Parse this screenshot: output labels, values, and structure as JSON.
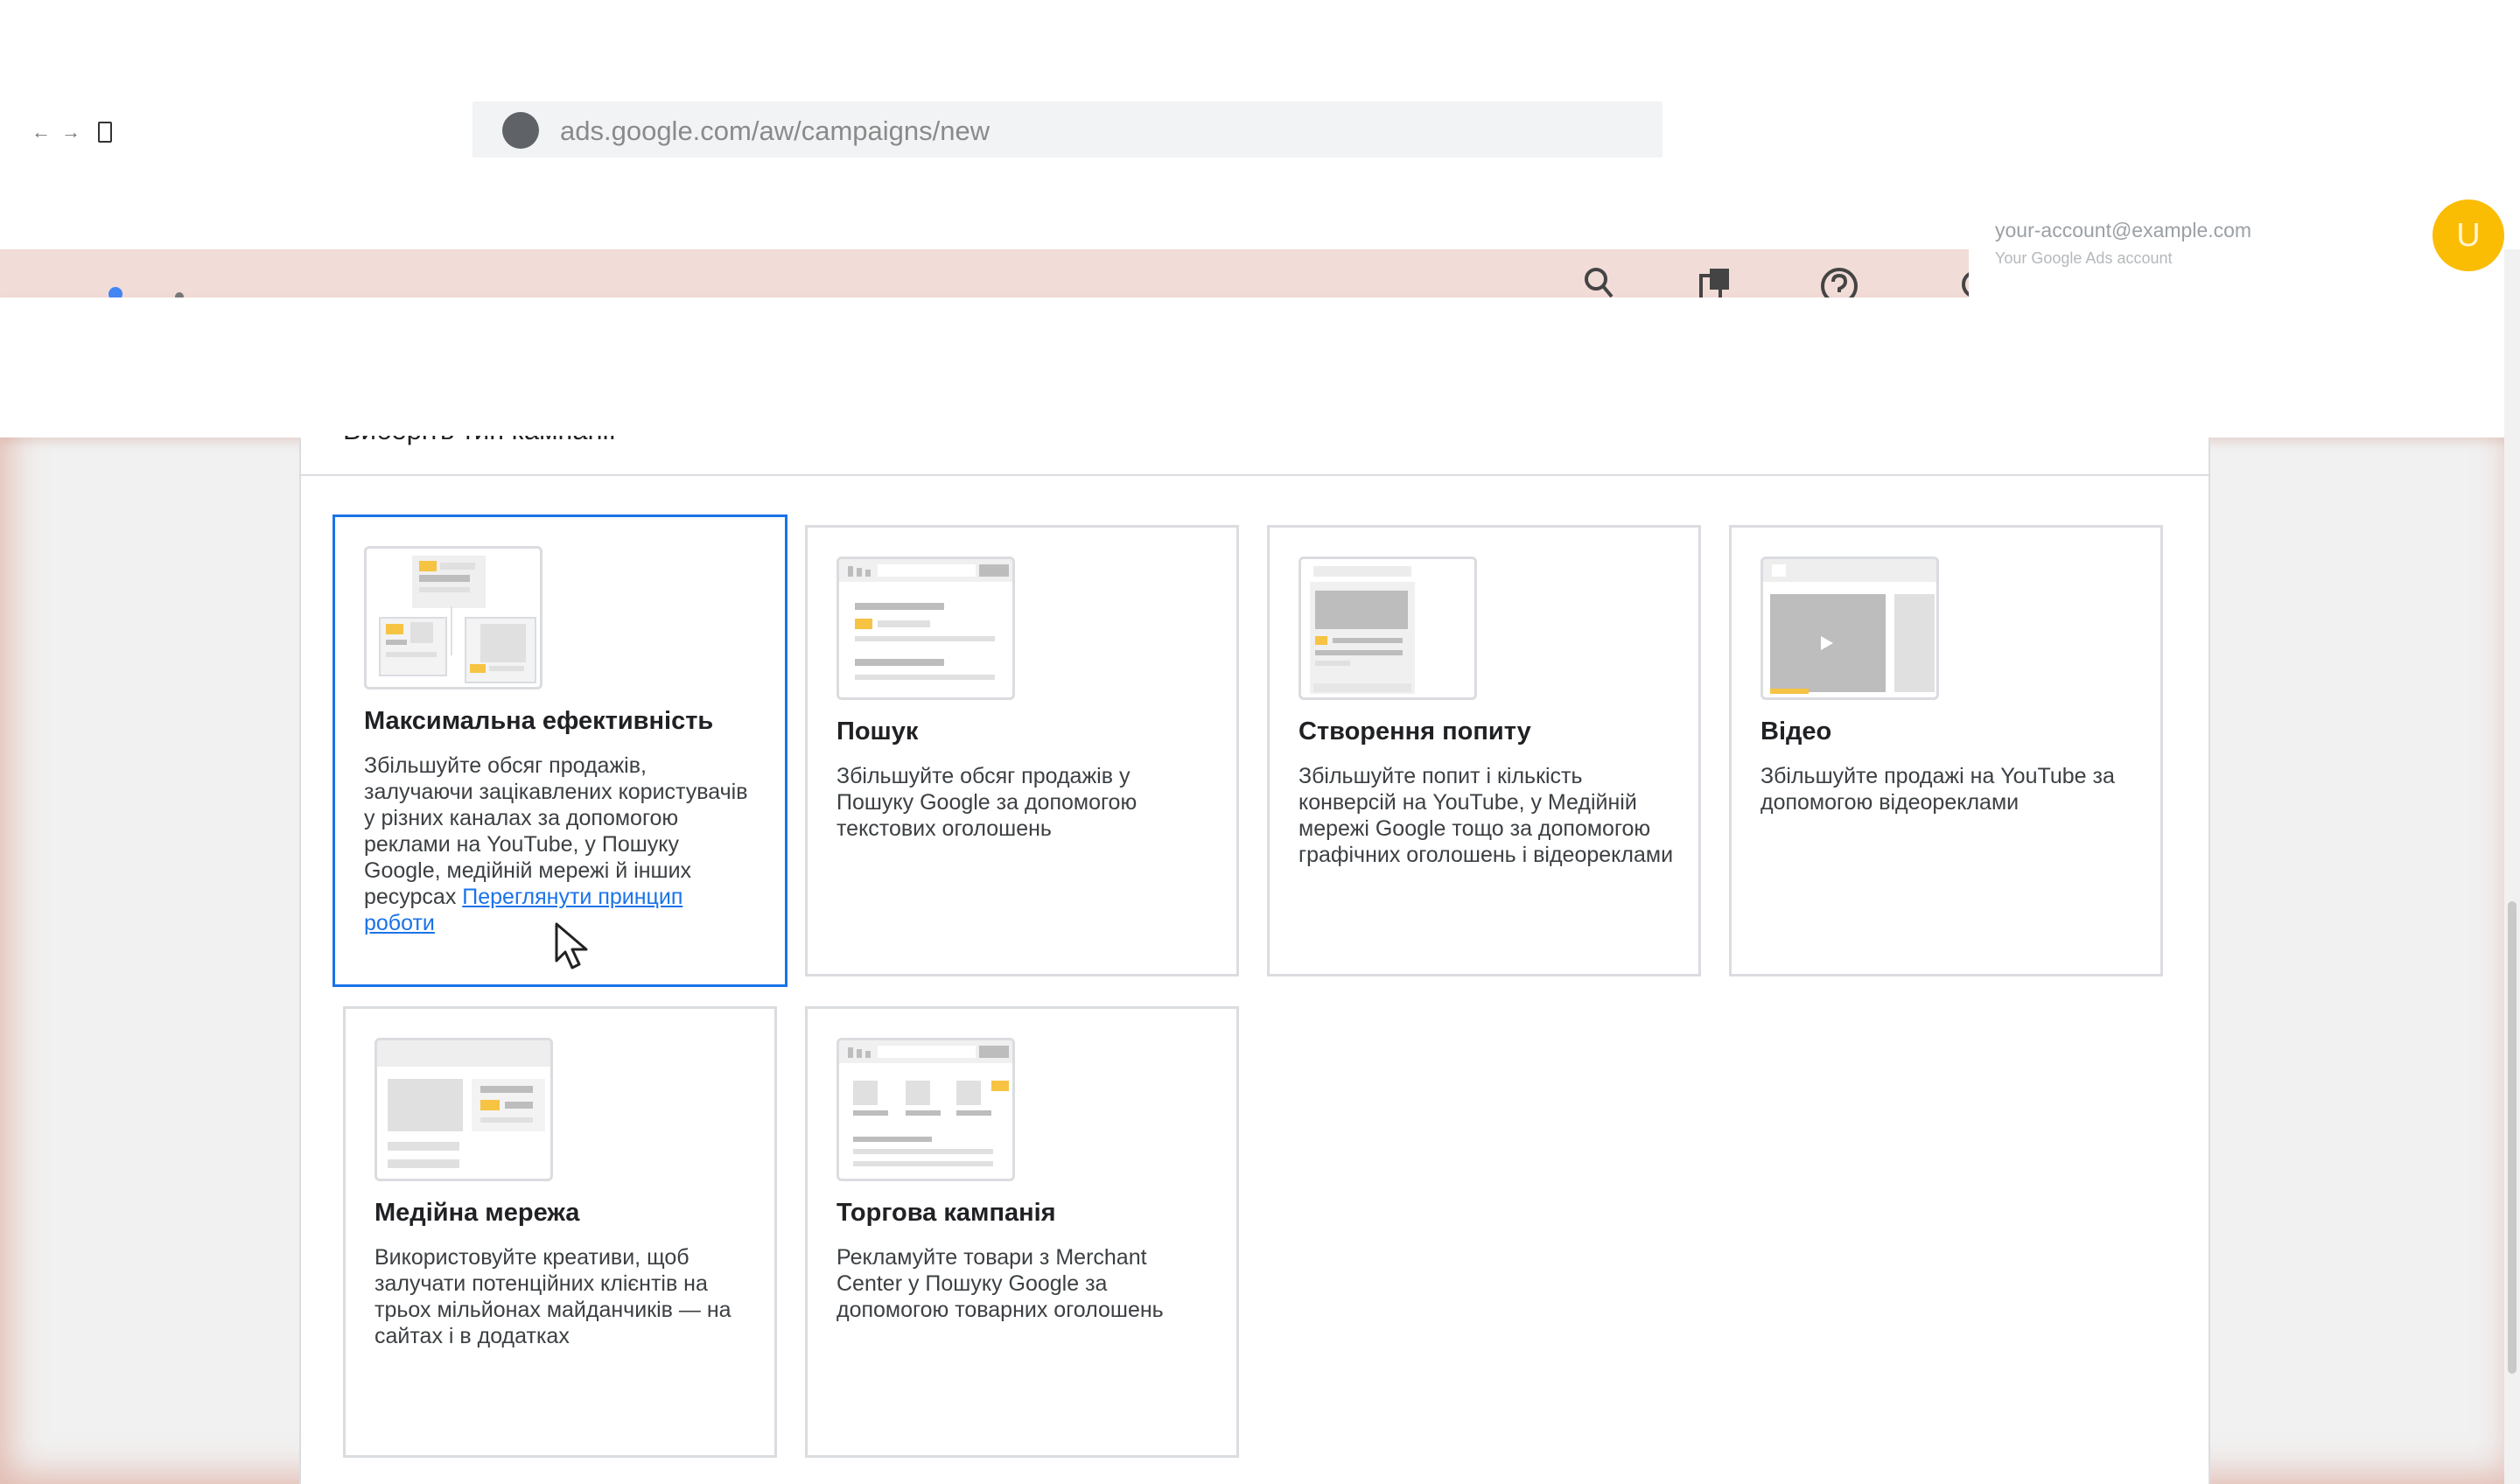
{
  "browser": {
    "url": "ads.google.com/aw/campaigns/new",
    "back_glyph": "←",
    "forward_glyph": "→"
  },
  "account": {
    "email": "your-account@example.com",
    "subtitle": "Your Google Ads account",
    "avatar_letter": "U"
  },
  "panel": {
    "title": "Виберіть тип кампанії"
  },
  "cards": [
    {
      "title": "Максимальна ефективність",
      "description": "Збільшуйте обсяг продажів, залучаючи зацікавлених користувачів у різних каналах за допомогою реклами на YouTube, у Пошуку Google, медійній мережі й інших ресурсах",
      "link": "Переглянути принцип роботи",
      "selected": true
    },
    {
      "title": "Пошук",
      "description": "Збільшуйте обсяг продажів у Пошуку Google за допомогою текстових оголошень"
    },
    {
      "title": "Створення попиту",
      "description": "Збільшуйте попит і кількість конверсій на YouTube, у Медійній мережі Google тощо за допомогою графічних оголошень і відеореклами"
    },
    {
      "title": "Відео",
      "description": "Збільшуйте продажі на YouTube за допомогою відеореклами"
    },
    {
      "title": "Медійна мережа",
      "description": "Використовуйте креативи, щоб залучати потенційних клієнтів на трьох мільйонах майданчиків — на сайтах і в додатках"
    },
    {
      "title": "Торгова кампанія",
      "description": "Рекламуйте товари з Merchant Center у Пошуку Google за допомогою товарних оголошень"
    }
  ],
  "colors": {
    "selected_border": "#1a73e8",
    "accent_yellow": "#f6c343",
    "avatar": "#fbbc04"
  },
  "icons": {
    "search": "search-icon",
    "devices": "devices-icon",
    "help": "help-icon"
  }
}
